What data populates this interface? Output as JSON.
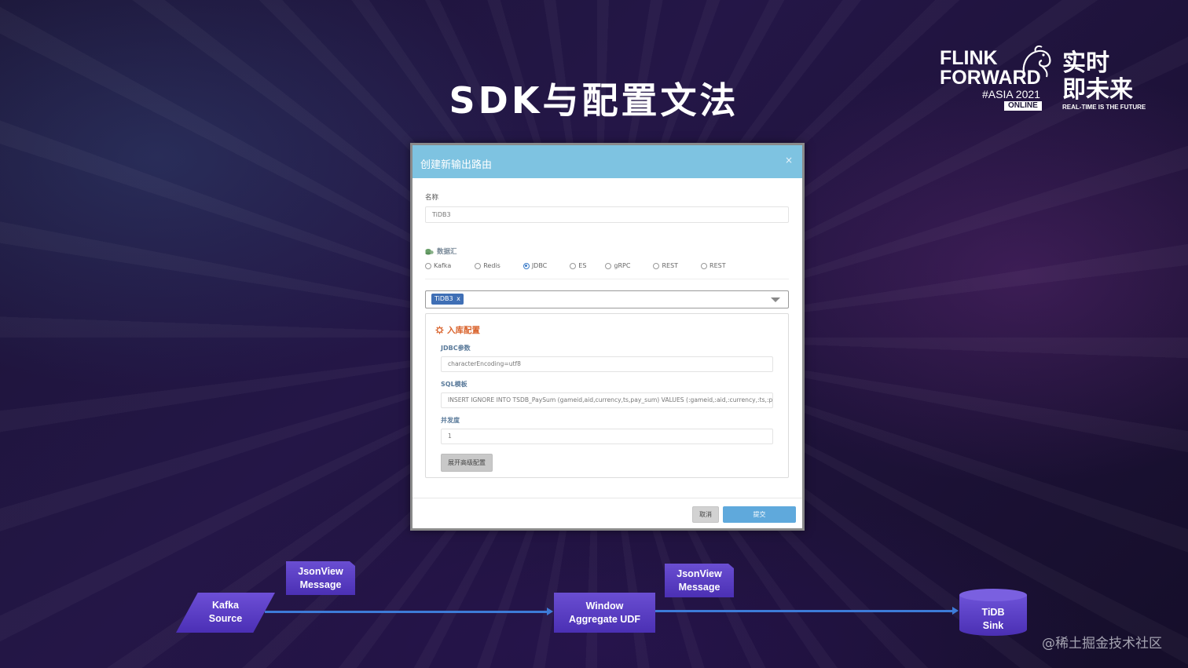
{
  "slide": {
    "title": "SDK与配置文法"
  },
  "logo": {
    "line1": "FLINK",
    "line2": "FORWARD",
    "event": "#ASIA 2021",
    "badge": "ONLINE",
    "cn_line1": "实时",
    "cn_line2": "即未来",
    "tagline": "REAL-TIME IS THE FUTURE"
  },
  "dialog": {
    "title": "创建新输出路由",
    "close_symbol": "×",
    "name_label": "名称",
    "name_value": "TiDB3",
    "sink_section_label": "数据汇",
    "radio_options": [
      "Kafka",
      "Redis",
      "JDBC",
      "ES",
      "gRPC",
      "REST",
      "REST"
    ],
    "selected_radio": "JDBC",
    "selected_tag": "TiDB3",
    "tag_remove": "x",
    "panel": {
      "title": "入库配置",
      "jdbc_label": "JDBC参数",
      "jdbc_value": "characterEncoding=utf8",
      "sql_label": "SQL模板",
      "sql_value": "INSERT IGNORE INTO TSDB_PaySum (gameid,aid,currency,ts,pay_sum) VALUES (:gameid,:aid,:currency,:ts,:pa",
      "parallel_label": "并发度",
      "parallel_value": "1",
      "advanced_button": "展开高级配置"
    },
    "cancel_label": "取消",
    "submit_label": "提交"
  },
  "flow": {
    "source": {
      "line1": "Kafka",
      "line2": "Source"
    },
    "msg1": {
      "line1": "JsonView",
      "line2": "Message"
    },
    "udf": {
      "line1": "Window",
      "line2": "Aggregate UDF"
    },
    "msg2": {
      "line1": "JsonView",
      "line2": "Message"
    },
    "sink": {
      "line1": "TiDB",
      "line2": "Sink"
    }
  },
  "watermark": "@稀土掘金技术社区",
  "colors": {
    "dialog_header": "#7ec3e1",
    "accent_orange": "#d9622b",
    "tag_blue": "#3f6fb5",
    "submit_blue": "#5fa9dc",
    "flow_purple": "#5b3fc6",
    "arrow_blue": "#3d7bd8"
  }
}
